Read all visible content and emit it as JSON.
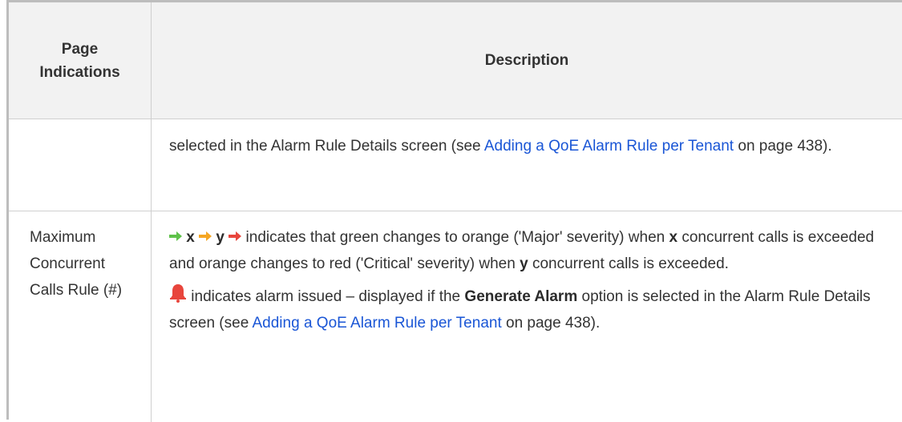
{
  "header": {
    "col1": "Page\nIndications",
    "col2": "Description"
  },
  "row1": {
    "desc_prefix": "selected in the Alarm Rule Details screen (see ",
    "link": "Adding a QoE Alarm Rule per Tenant",
    "desc_suffix": " on page 438)."
  },
  "row2": {
    "indication": "Maximum Concurrent Calls Rule (#)",
    "var_x": "x",
    "var_y": "y",
    "arrows_text": " indicates that green changes to orange ('Major' severity) when ",
    "bold_x": "x",
    "text_mid": " concurrent calls is exceeded and orange changes to red ('Critical' severity) when ",
    "bold_y": "y",
    "text_end": " concurrent calls is exceeded.",
    "bell_text": " indicates alarm issued – displayed if the ",
    "bold_option": "Generate Alarm",
    "bell_text2": " option is selected in the Alarm Rule Details screen (see ",
    "link": "Adding a QoE Alarm Rule per Tenant",
    "desc_suffix": " on page 438)."
  },
  "colors": {
    "arrow_green": "#5fc24a",
    "arrow_orange": "#f5a623",
    "arrow_red": "#e8453c",
    "bell_red": "#e8453c",
    "link": "#1a56d6",
    "header_bg": "#f2f2f2"
  },
  "icons": [
    "green-arrow-icon",
    "orange-arrow-icon",
    "red-arrow-icon",
    "alarm-bell-icon"
  ]
}
